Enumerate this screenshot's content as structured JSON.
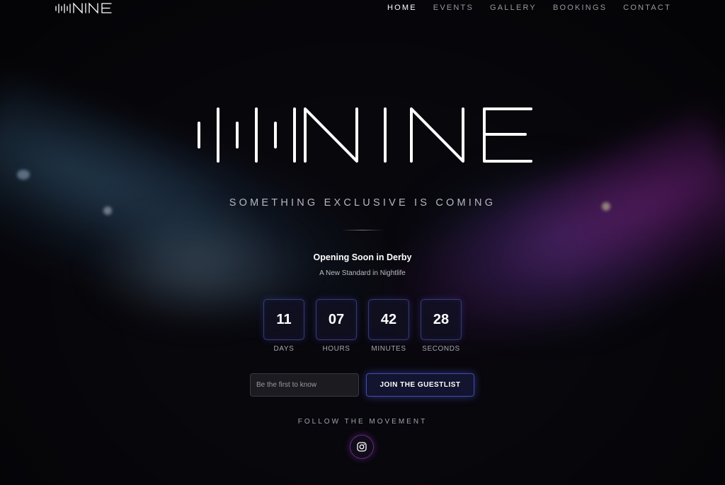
{
  "brand": {
    "name": "NINE"
  },
  "nav": {
    "items": [
      {
        "label": "HOME",
        "active": true
      },
      {
        "label": "EVENTS",
        "active": false
      },
      {
        "label": "GALLERY",
        "active": false
      },
      {
        "label": "BOOKINGS",
        "active": false
      },
      {
        "label": "CONTACT",
        "active": false
      }
    ]
  },
  "hero": {
    "tagline": "SOMETHING EXCLUSIVE IS COMING",
    "heading": "Opening Soon in Derby",
    "subheading": "A New Standard in Nightlife"
  },
  "countdown": {
    "days": {
      "value": "11",
      "label": "DAYS"
    },
    "hours": {
      "value": "07",
      "label": "HOURS"
    },
    "minutes": {
      "value": "42",
      "label": "MINUTES"
    },
    "seconds": {
      "value": "28",
      "label": "SECONDS"
    }
  },
  "signup": {
    "placeholder": "Be the first to know",
    "button_label": "JOIN THE GUESTLIST"
  },
  "social": {
    "heading": "FOLLOW THE MOVEMENT",
    "icon": "instagram-icon"
  },
  "colors": {
    "background": "#08070c",
    "accent_blue": "#5a64e6",
    "accent_purple": "#a03cc8"
  }
}
